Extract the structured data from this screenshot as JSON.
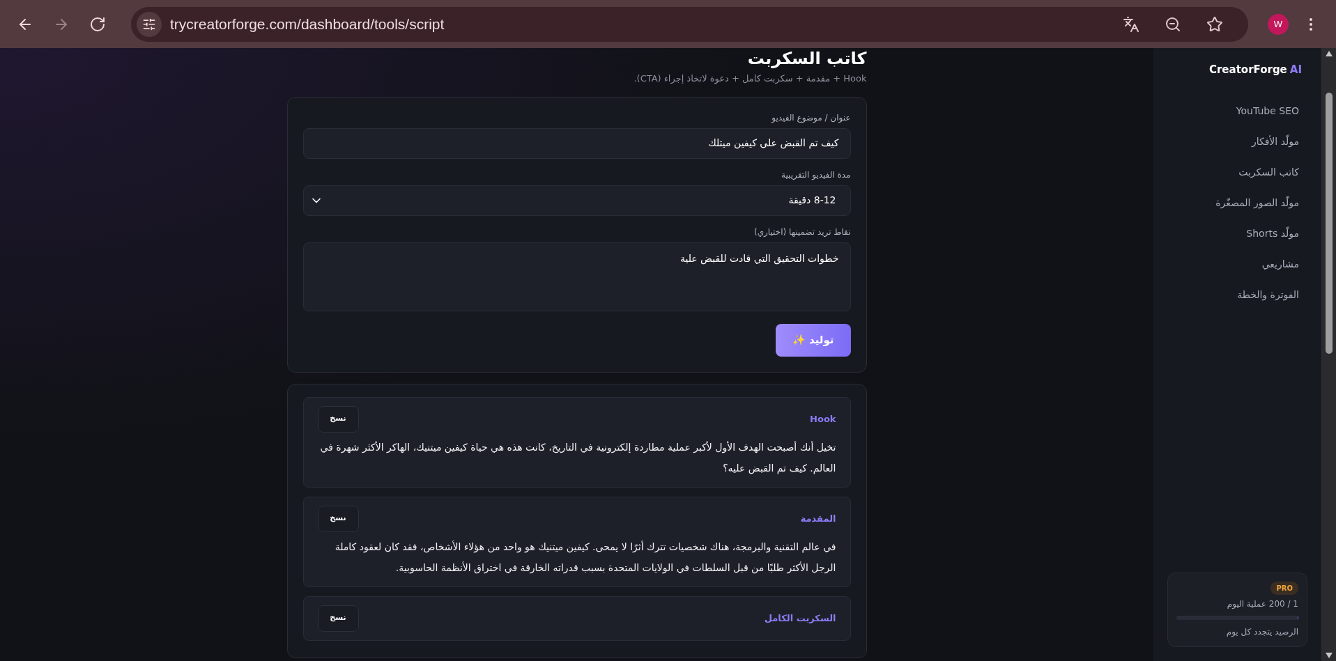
{
  "browser": {
    "url": "trycreatorforge.com/dashboard/tools/script",
    "avatar": "W"
  },
  "page": {
    "title": "كاتب السكربت",
    "subtitle": "Hook + مقدمة + سكربت كامل + دعوة لاتخاذ إجراء (CTA)."
  },
  "form": {
    "fields": [
      {
        "kind": "input",
        "label": "عنوان / موضوع الفيديو",
        "value": "كيف تم القبض على كيفين ميتلك"
      },
      {
        "kind": "select",
        "label": "مدة الفيديو التقريبية",
        "value": "8-12 دقيقة"
      },
      {
        "kind": "textarea",
        "label": "نقاط تريد تضمينها (اختياري)",
        "value": "خطوات التحقيق التي قادت للقبض علية"
      }
    ],
    "submit": "توليد ✨"
  },
  "results": [
    {
      "title": "Hook",
      "copy": "نسخ",
      "text": "تخيل أنك أصبحت الهدف الأول لأكبر عملية مطاردة إلكترونية في التاريخ، كانت هذه هي حياة كيفين ميتنيك، الهاكر الأكثر شهرة في العالم. كيف تم القبض عليه؟"
    },
    {
      "title": "المقدمة",
      "copy": "نسخ",
      "text": "في عالم التقنية والبرمجة، هناك شخصيات تترك أثرًا لا يمحى. كيفين ميتنيك هو واحد من هؤلاء الأشخاص، فقد كان لعقود كاملة الرجل الأكثر طلبًا من قبل السلطات في الولايات المتحدة بسبب قدراته الخارقة في اختراق الأنظمة الحاسوبية."
    },
    {
      "title": "السكربت الكامل",
      "copy": "نسخ"
    }
  ],
  "sidebar": {
    "logo": "CreatorForge",
    "logo_accent": "AI",
    "items": [
      {
        "label": "YouTube SEO",
        "selected": false
      },
      {
        "label": "مولّد الأفكار",
        "selected": false
      },
      {
        "label": "كاتب السكربت",
        "selected": false
      },
      {
        "label": "مولّد الصور المصغّرة",
        "selected": false
      },
      {
        "label": "مولّد Shorts",
        "selected": false
      },
      {
        "label": "مشاريعي",
        "selected": false
      },
      {
        "label": "الفوترة والخطة",
        "selected": false
      }
    ],
    "plan": {
      "badge": "PRO",
      "usage": "1 / 200 عملية اليوم",
      "level": 0.005,
      "note": "الرصيد يتجدد كل يوم"
    }
  }
}
